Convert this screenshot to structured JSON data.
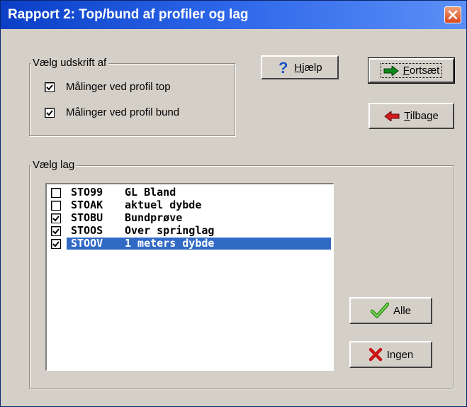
{
  "window": {
    "title": "Rapport 2: Top/bund af profiler og lag"
  },
  "print_group": {
    "legend": "Vælg udskrift af",
    "options": [
      {
        "label": "Målinger ved profil top",
        "checked": true
      },
      {
        "label": "Målinger ved profil bund",
        "checked": true
      }
    ]
  },
  "buttons": {
    "help": {
      "label": "Hjælp",
      "hotkey": "H",
      "rest": "jælp",
      "icon": "question-icon"
    },
    "continue": {
      "label": "Fortsæt",
      "hotkey": "F",
      "rest": "ortsæt",
      "icon": "green-arrow-right-icon"
    },
    "back": {
      "label": "Tilbage",
      "hotkey": "T",
      "rest": "ilbage",
      "icon": "red-arrow-left-icon"
    },
    "all": {
      "label": "Alle",
      "icon": "checkmark-icon"
    },
    "none": {
      "label": "Ingen",
      "icon": "red-x-icon"
    }
  },
  "layer_group": {
    "legend": "Vælg lag",
    "items": [
      {
        "code": "STO99",
        "name": "GL Bland",
        "checked": false,
        "selected": false
      },
      {
        "code": "STOAK",
        "name": "aktuel dybde",
        "checked": false,
        "selected": false
      },
      {
        "code": "STOBU",
        "name": "Bundprøve",
        "checked": true,
        "selected": false
      },
      {
        "code": "STOOS",
        "name": "Over springlag",
        "checked": true,
        "selected": false
      },
      {
        "code": "STOOV",
        "name": "1 meters dybde",
        "checked": true,
        "selected": true
      }
    ]
  },
  "colors": {
    "selection": "#316ac5",
    "titlebar": "#0a3fc6",
    "face": "#d4d0c8"
  }
}
